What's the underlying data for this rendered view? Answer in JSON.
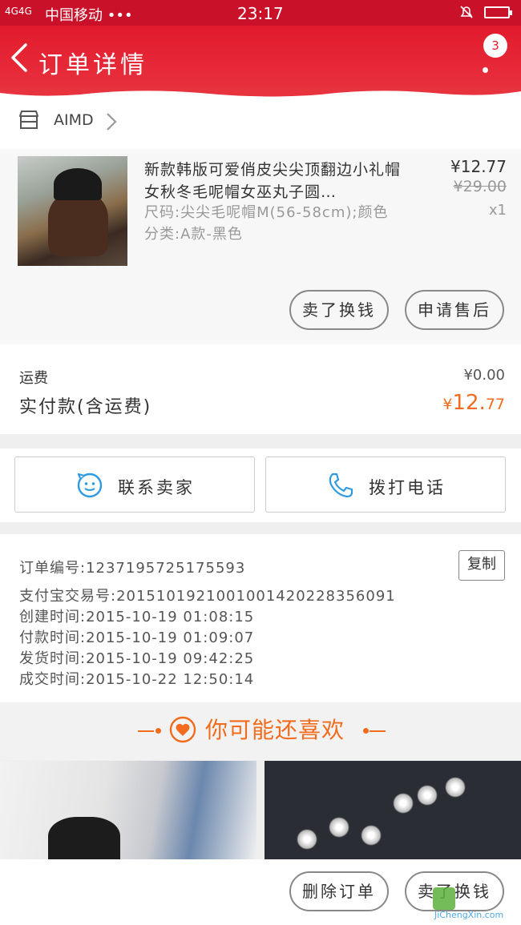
{
  "status_bar": {
    "signal": "4G4G",
    "carrier": "中国移动 •••",
    "time": "23:17"
  },
  "header": {
    "title": "订单详情",
    "badge": "3"
  },
  "shop": {
    "name": "AIMD"
  },
  "product": {
    "title": "新款韩版可爱俏皮尖尖顶翻边小礼帽女秋冬毛呢帽女巫丸子圆…",
    "spec": "尺码:尖尖毛呢帽M(56-58cm);颜色分类:A款-黑色",
    "price": "¥12.77",
    "original_price": "¥29.00",
    "quantity": "x1"
  },
  "actions": {
    "resell": "卖了换钱",
    "after_sale": "申请售后"
  },
  "totals": {
    "shipping_label": "运费",
    "shipping_value": "¥0.00",
    "paid_label": "实付款(含运费)",
    "paid_symbol": "¥",
    "paid_int": "12.",
    "paid_dec": "77"
  },
  "contact": {
    "seller": "联系卖家",
    "call": "拨打电话"
  },
  "order_info": {
    "order_no": "订单编号:1237195725175593",
    "copy": "复制",
    "alipay_no": "支付宝交易号:2015101921001001420228356091",
    "created": "创建时间:2015-10-19 01:08:15",
    "paid": "付款时间:2015-10-19 01:09:07",
    "shipped": "发货时间:2015-10-19 09:42:25",
    "completed": "成交时间:2015-10-22 12:50:14"
  },
  "recommend": {
    "title": "你可能还喜欢"
  },
  "bottom": {
    "delete": "删除订单",
    "resell": "卖了换钱"
  },
  "watermark": {
    "text": "JiChengXin.com"
  },
  "colors": {
    "header_red": "#e21a2c",
    "accent_orange": "#f36b1c",
    "contact_blue": "#2e9be0"
  }
}
